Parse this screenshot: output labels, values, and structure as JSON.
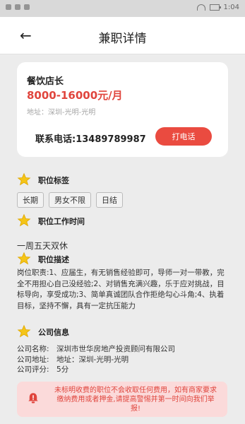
{
  "status_bar": {
    "time": "1:04"
  },
  "header": {
    "title": "兼职详情"
  },
  "job": {
    "name": "餐饮店长",
    "salary": "8000-16000元/月",
    "address": "地址：深圳-光明-光明",
    "phone": "联系电话:13489789987",
    "call_label": "打电话"
  },
  "sections": {
    "tags_title": "职位标签",
    "worktime_title": "职位工作时间",
    "desc_title": "职位描述",
    "company_title": "公司信息"
  },
  "tags": [
    "长期",
    "男女不限",
    "日结"
  ],
  "worktime": "一周五天双休",
  "description": "岗位职责:1、应届生，有无销售经验即可，导师一对一带教，完全不用担心自己没经验;2、对销售充满兴趣，乐于应对挑战，目标导向，享受成功;3、简单真诚团队合作拒绝勾心斗角;4、执着目标，坚持不懈，具有一定抗压能力",
  "company": {
    "name": "公司名称:　深圳市世华房地产投资顾问有限公司",
    "address": "公司地址:　地址：深圳-光明-光明",
    "rating": "公司评分:　5分"
  },
  "notice": "未标明收费的职位不会收取任何费用，如有商家要求缴纳费用或者押金,请提高警惕并第一时间向我们举报!",
  "colors": {
    "accent": "#e0453d",
    "star": "#f5c518"
  }
}
